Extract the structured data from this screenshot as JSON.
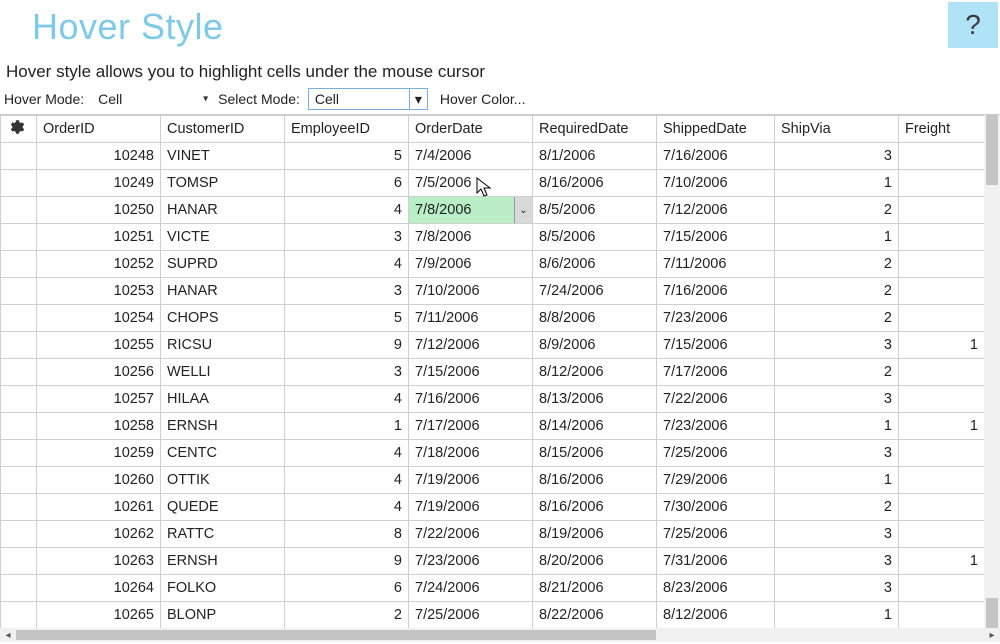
{
  "colors": {
    "title": "#7fc9e8",
    "help_bg": "#b0e3f8",
    "hover_cell": "#b9eec6",
    "combo_border": "#7baedb"
  },
  "header": {
    "title": "Hover Style",
    "help_label": "?"
  },
  "subtitle": "Hover style allows you to highlight cells under the mouse cursor",
  "toolbar": {
    "hover_mode_label": "Hover Mode:",
    "hover_mode_value": "Cell",
    "select_mode_label": "Select Mode:",
    "select_mode_value": "Cell",
    "hover_color_label": "Hover Color..."
  },
  "grid": {
    "columns": [
      "OrderID",
      "CustomerID",
      "EmployeeID",
      "OrderDate",
      "RequiredDate",
      "ShippedDate",
      "ShipVia",
      "Freight"
    ],
    "numeric_cols": [
      0,
      2,
      6,
      7
    ],
    "hovered": {
      "row": 2,
      "col": 3
    },
    "rows": [
      {
        "OrderID": 10248,
        "CustomerID": "VINET",
        "EmployeeID": 5,
        "OrderDate": "7/4/2006",
        "RequiredDate": "8/1/2006",
        "ShippedDate": "7/16/2006",
        "ShipVia": 3,
        "Freight": ""
      },
      {
        "OrderID": 10249,
        "CustomerID": "TOMSP",
        "EmployeeID": 6,
        "OrderDate": "7/5/2006",
        "RequiredDate": "8/16/2006",
        "ShippedDate": "7/10/2006",
        "ShipVia": 1,
        "Freight": ""
      },
      {
        "OrderID": 10250,
        "CustomerID": "HANAR",
        "EmployeeID": 4,
        "OrderDate": "7/8/2006",
        "RequiredDate": "8/5/2006",
        "ShippedDate": "7/12/2006",
        "ShipVia": 2,
        "Freight": ""
      },
      {
        "OrderID": 10251,
        "CustomerID": "VICTE",
        "EmployeeID": 3,
        "OrderDate": "7/8/2006",
        "RequiredDate": "8/5/2006",
        "ShippedDate": "7/15/2006",
        "ShipVia": 1,
        "Freight": ""
      },
      {
        "OrderID": 10252,
        "CustomerID": "SUPRD",
        "EmployeeID": 4,
        "OrderDate": "7/9/2006",
        "RequiredDate": "8/6/2006",
        "ShippedDate": "7/11/2006",
        "ShipVia": 2,
        "Freight": ""
      },
      {
        "OrderID": 10253,
        "CustomerID": "HANAR",
        "EmployeeID": 3,
        "OrderDate": "7/10/2006",
        "RequiredDate": "7/24/2006",
        "ShippedDate": "7/16/2006",
        "ShipVia": 2,
        "Freight": ""
      },
      {
        "OrderID": 10254,
        "CustomerID": "CHOPS",
        "EmployeeID": 5,
        "OrderDate": "7/11/2006",
        "RequiredDate": "8/8/2006",
        "ShippedDate": "7/23/2006",
        "ShipVia": 2,
        "Freight": ""
      },
      {
        "OrderID": 10255,
        "CustomerID": "RICSU",
        "EmployeeID": 9,
        "OrderDate": "7/12/2006",
        "RequiredDate": "8/9/2006",
        "ShippedDate": "7/15/2006",
        "ShipVia": 3,
        "Freight": "1"
      },
      {
        "OrderID": 10256,
        "CustomerID": "WELLI",
        "EmployeeID": 3,
        "OrderDate": "7/15/2006",
        "RequiredDate": "8/12/2006",
        "ShippedDate": "7/17/2006",
        "ShipVia": 2,
        "Freight": ""
      },
      {
        "OrderID": 10257,
        "CustomerID": "HILAA",
        "EmployeeID": 4,
        "OrderDate": "7/16/2006",
        "RequiredDate": "8/13/2006",
        "ShippedDate": "7/22/2006",
        "ShipVia": 3,
        "Freight": ""
      },
      {
        "OrderID": 10258,
        "CustomerID": "ERNSH",
        "EmployeeID": 1,
        "OrderDate": "7/17/2006",
        "RequiredDate": "8/14/2006",
        "ShippedDate": "7/23/2006",
        "ShipVia": 1,
        "Freight": "1"
      },
      {
        "OrderID": 10259,
        "CustomerID": "CENTC",
        "EmployeeID": 4,
        "OrderDate": "7/18/2006",
        "RequiredDate": "8/15/2006",
        "ShippedDate": "7/25/2006",
        "ShipVia": 3,
        "Freight": ""
      },
      {
        "OrderID": 10260,
        "CustomerID": "OTTIK",
        "EmployeeID": 4,
        "OrderDate": "7/19/2006",
        "RequiredDate": "8/16/2006",
        "ShippedDate": "7/29/2006",
        "ShipVia": 1,
        "Freight": ""
      },
      {
        "OrderID": 10261,
        "CustomerID": "QUEDE",
        "EmployeeID": 4,
        "OrderDate": "7/19/2006",
        "RequiredDate": "8/16/2006",
        "ShippedDate": "7/30/2006",
        "ShipVia": 2,
        "Freight": ""
      },
      {
        "OrderID": 10262,
        "CustomerID": "RATTC",
        "EmployeeID": 8,
        "OrderDate": "7/22/2006",
        "RequiredDate": "8/19/2006",
        "ShippedDate": "7/25/2006",
        "ShipVia": 3,
        "Freight": ""
      },
      {
        "OrderID": 10263,
        "CustomerID": "ERNSH",
        "EmployeeID": 9,
        "OrderDate": "7/23/2006",
        "RequiredDate": "8/20/2006",
        "ShippedDate": "7/31/2006",
        "ShipVia": 3,
        "Freight": "1"
      },
      {
        "OrderID": 10264,
        "CustomerID": "FOLKO",
        "EmployeeID": 6,
        "OrderDate": "7/24/2006",
        "RequiredDate": "8/21/2006",
        "ShippedDate": "8/23/2006",
        "ShipVia": 3,
        "Freight": ""
      },
      {
        "OrderID": 10265,
        "CustomerID": "BLONP",
        "EmployeeID": 2,
        "OrderDate": "7/25/2006",
        "RequiredDate": "8/22/2006",
        "ShippedDate": "8/12/2006",
        "ShipVia": 1,
        "Freight": ""
      }
    ]
  }
}
